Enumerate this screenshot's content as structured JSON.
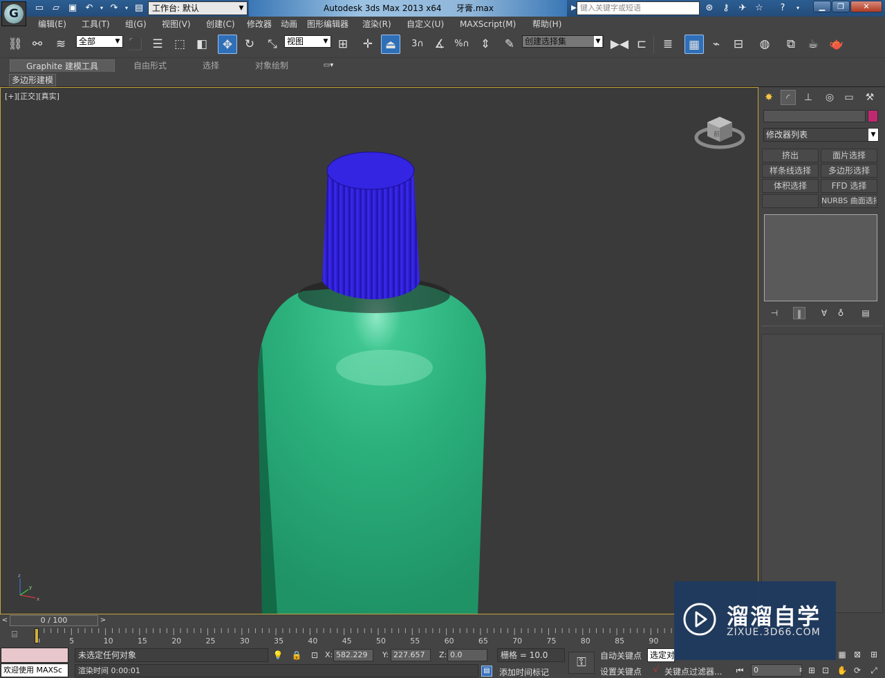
{
  "titlebar": {
    "workspace_label": "工作台: 默认",
    "app_title": "Autodesk 3ds Max  2013 x64",
    "file_name": "牙膏.max",
    "search_placeholder": "键入关键字或短语"
  },
  "menu": {
    "items": [
      "编辑(E)",
      "工具(T)",
      "组(G)",
      "视图(V)",
      "创建(C)",
      "修改器",
      "动画",
      "图形编辑器",
      "渲染(R)",
      "自定义(U)",
      "MAXScript(M)",
      "帮助(H)"
    ]
  },
  "toolbar": {
    "selection_filter": "全部",
    "reference_coord": "视图",
    "snap_angle": "3",
    "named_selection_set": "创建选择集"
  },
  "ribbon": {
    "tabs": [
      "Graphite 建模工具",
      "自由形式",
      "选择",
      "对象绘制"
    ],
    "panel_label": "多边形建模"
  },
  "viewport": {
    "label": "[+][正交][真实]",
    "viewcube_face": "前"
  },
  "command_panel": {
    "object_color": "#c0296f",
    "modifier_list": "修改器列表",
    "modifier_buttons": [
      "挤出",
      "面片选择",
      "样条线选择",
      "多边形选择",
      "体积选择",
      "FFD 选择",
      "",
      "NURBS 曲面选择"
    ]
  },
  "timeline": {
    "slider_label": "0 / 100",
    "ticks": [
      "0",
      "5",
      "10",
      "15",
      "20",
      "25",
      "30",
      "35",
      "40",
      "45",
      "50",
      "55",
      "60",
      "65",
      "70",
      "75",
      "80",
      "85",
      "90"
    ]
  },
  "status": {
    "welcome": "欢迎使用 MAXSc",
    "selection": "未选定任何对象",
    "render_time": "渲染时间  0:00:01",
    "x_label": "X:",
    "x_value": "582.229",
    "y_label": "Y:",
    "y_value": "227.657",
    "z_label": "Z:",
    "z_value": "0.0",
    "grid": "栅格 = 10.0",
    "add_time_tag": "添加时间标记",
    "auto_key": "自动关键点",
    "set_key": "设置关键点",
    "selected": "选定对",
    "key_filters": "关键点过滤器...",
    "frame": "0"
  },
  "watermark": {
    "title": "溜溜自学",
    "url": "ZIXUE.3D66.COM"
  },
  "colors": {
    "cap": "#2d1fd6",
    "tube": "#2cb07e",
    "viewport_border": "#c8a53a"
  }
}
